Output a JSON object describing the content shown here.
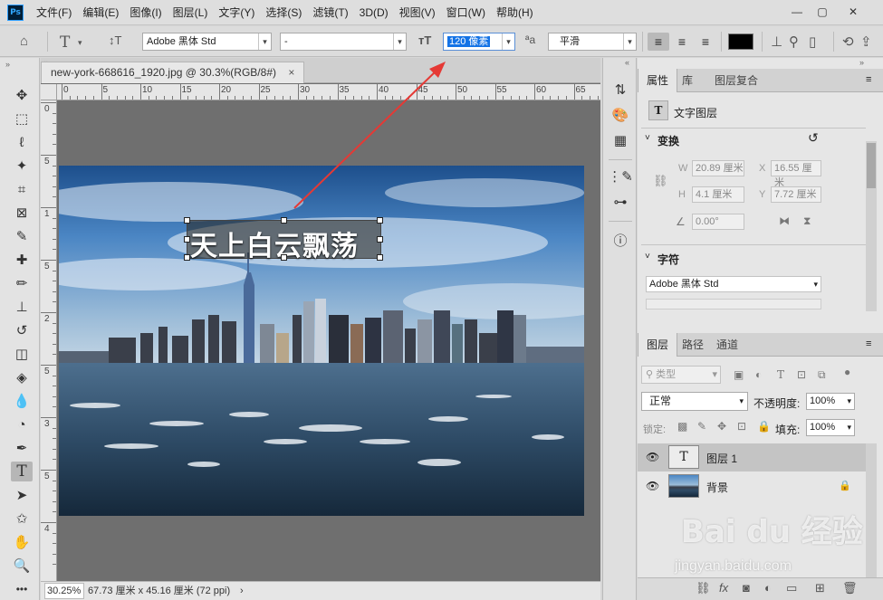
{
  "app": {
    "logo": "Ps"
  },
  "menu": [
    "文件(F)",
    "编辑(E)",
    "图像(I)",
    "图层(L)",
    "文字(Y)",
    "选择(S)",
    "滤镜(T)",
    "3D(D)",
    "视图(V)",
    "窗口(W)",
    "帮助(H)"
  ],
  "window_controls": {
    "minimize": "—",
    "restore": "▢",
    "close": "✕"
  },
  "options": {
    "font_family": "Adobe 黑体 Std",
    "font_style": "-",
    "font_size": "120 像素",
    "antialias_icon": "ªa",
    "antialias": "平滑",
    "text_color": "#000000"
  },
  "document": {
    "tab_title": "new-york-668616_1920.jpg @ 30.3%(RGB/8#)",
    "tab_close": "×",
    "ruler_h": [
      "0",
      "5",
      "10",
      "15",
      "20",
      "25",
      "30",
      "35",
      "40",
      "45",
      "50",
      "55",
      "60",
      "65"
    ],
    "ruler_v": [
      "0",
      "5",
      "1",
      "5",
      "2",
      "5",
      "3",
      "5",
      "4"
    ],
    "text_content": "天上白云飘荡",
    "zoom": "30.25%",
    "doc_size": "67.73 厘米 x 45.16 厘米 (72 ppi)",
    "status_arrow": "›"
  },
  "properties": {
    "tabs": [
      "属性",
      "库",
      "图层复合"
    ],
    "layer_type": "文字图层",
    "transform_title": "变换",
    "w_label": "W",
    "w": "20.89 厘米",
    "x_label": "X",
    "x": "16.55 厘米",
    "h_label": "H",
    "h": "4.1 厘米",
    "y_label": "Y",
    "y": "7.72 厘米",
    "angle": "0.00°",
    "character_title": "字符",
    "font": "Adobe 黑体 Std"
  },
  "layers_panel": {
    "tabs": [
      "图层",
      "路径",
      "通道"
    ],
    "filter_placeholder": "类型",
    "blend_mode": "正常",
    "opacity_label": "不透明度:",
    "opacity": "100%",
    "lock_label": "锁定:",
    "fill_label": "填充:",
    "fill": "100%",
    "layers": [
      {
        "name": "图层 1",
        "type": "text",
        "selected": true,
        "thumb": "T"
      },
      {
        "name": "背景",
        "type": "image",
        "selected": false,
        "locked": true
      }
    ],
    "footer_icons": [
      "link-icon",
      "fx-icon",
      "mask-icon",
      "adjustment-icon",
      "folder-icon",
      "new-layer-icon",
      "trash-icon"
    ]
  },
  "watermark": {
    "brand": "Bai du 经验",
    "url": "jingyan.baidu.com"
  },
  "colors": {
    "accent": "#1473e6",
    "annotation_arrow": "#e53935",
    "selected_layer": "#c4c4c4",
    "canvas_bg": "#6f6f6f"
  }
}
